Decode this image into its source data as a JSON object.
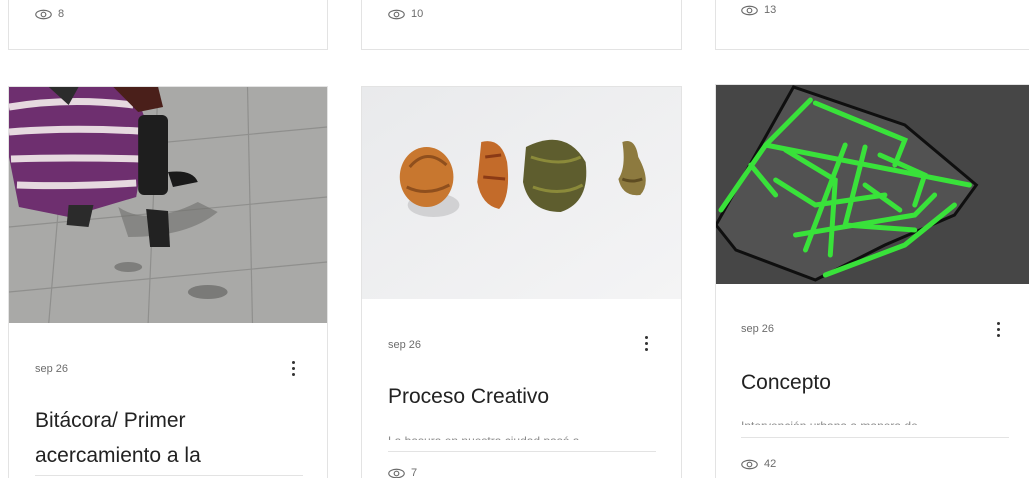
{
  "top_row": [
    {
      "views": "8"
    },
    {
      "views": "10"
    },
    {
      "views": "13"
    }
  ],
  "posts": [
    {
      "date": "sep 26",
      "title_line1": "Bitácora/ Primer",
      "title_line2": "acercamiento a la",
      "image": "woman-walking-on-sidewalk"
    },
    {
      "date": "sep 26",
      "title_line1": "Proceso Creativo",
      "excerpt": "La basura en nuestra ciudad pasó a",
      "views": "7",
      "image": "four-organic-objects-on-white"
    },
    {
      "date": "sep 26",
      "title_line1": "Concepto",
      "excerpt": "Intervención urbana a manera de",
      "views": "42",
      "image": "green-street-map-diagram"
    }
  ],
  "colors": {
    "map_bg": "#464646",
    "map_lines": "#39e23a",
    "border": "#e3e3e3"
  }
}
